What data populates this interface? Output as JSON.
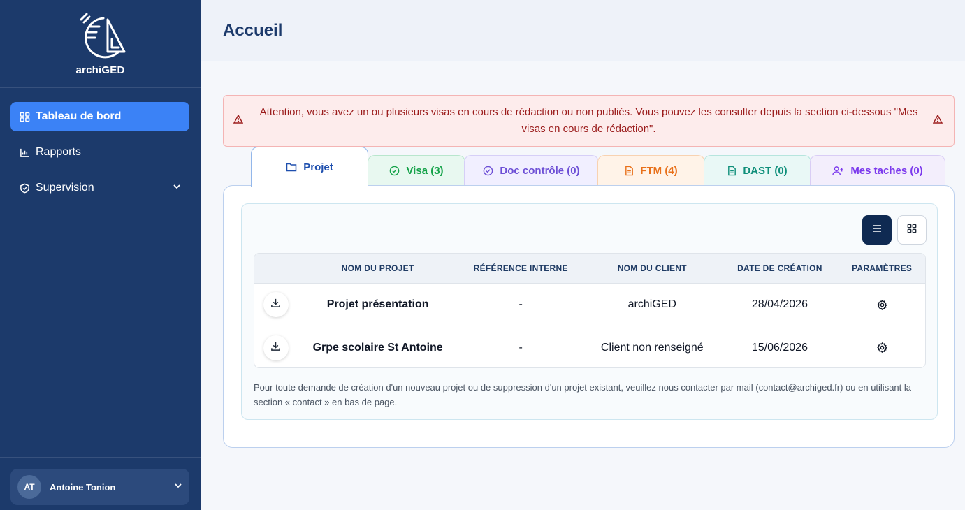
{
  "brand": {
    "name": "archiGED"
  },
  "sidebar": {
    "items": [
      {
        "label": "Tableau de bord",
        "icon": "dashboard-grid-icon",
        "active": true
      },
      {
        "label": "Rapports",
        "icon": "bar-chart-icon"
      },
      {
        "label": "Supervision",
        "icon": "shield-check-icon",
        "has_submenu": true
      }
    ],
    "user": {
      "initials": "AT",
      "name": "Antoine Tonion"
    }
  },
  "header": {
    "title": "Accueil"
  },
  "alert": {
    "text": "Attention, vous avez un ou plusieurs visas en cours de rédaction ou non publiés. Vous pouvez les consulter depuis la section ci-dessous \"Mes visas en cours de rédaction\"."
  },
  "tabs": [
    {
      "label": "Projet",
      "icon": "folder-icon",
      "active": true
    },
    {
      "label": "Visa (3)",
      "icon": "check-circle-icon"
    },
    {
      "label": "Doc contrôle (0)",
      "icon": "check-circle-icon"
    },
    {
      "label": "FTM (4)",
      "icon": "document-icon"
    },
    {
      "label": "DAST (0)",
      "icon": "document-icon"
    },
    {
      "label": "Mes taches (0)",
      "icon": "user-plus-icon"
    }
  ],
  "table": {
    "columns": [
      "NOM DU PROJET",
      "RÉFÉRENCE INTERNE",
      "NOM DU CLIENT",
      "DATE DE CRÉATION",
      "PARAMÈTRES"
    ],
    "rows": [
      {
        "name": "Projet présentation",
        "ref": "-",
        "client": "archiGED",
        "date": "28/04/2026"
      },
      {
        "name": "Grpe scolaire St Antoine",
        "ref": "-",
        "client": "Client non renseigné",
        "date": "15/06/2026"
      }
    ]
  },
  "note": "Pour toute demande de création d'un nouveau projet ou de suppression d'un projet existant, veuillez nous contacter par mail (contact@archiged.fr) ou en utilisant la section « contact » en bas de page.",
  "colors": {
    "sidebar": "#1c3a6b",
    "accent": "#3b82f6",
    "alert_bg": "#fdecec",
    "alert_text": "#9b1c1c"
  }
}
